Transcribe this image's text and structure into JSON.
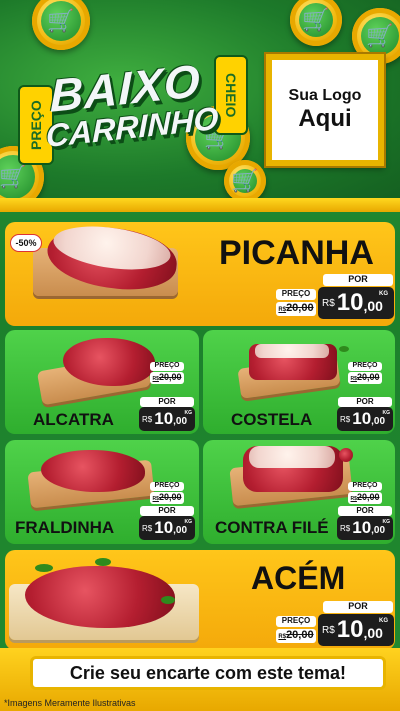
{
  "header": {
    "title_line1": "BAIXO",
    "title_line2": "CARRINHO",
    "side_left": "PREÇO",
    "side_right": "CHEIO",
    "logo_line1": "Sua Logo",
    "logo_line2": "Aqui"
  },
  "products": {
    "picanha": {
      "name": "PICANHA",
      "discount": "-50%",
      "preco_label": "PREÇO",
      "old": "20,00",
      "old_prefix": "R$",
      "por_label": "POR",
      "currency": "R$",
      "int": "10",
      "dec": ",00",
      "unit": "KG"
    },
    "alcatra": {
      "name": "ALCATRA",
      "preco_label": "PREÇO",
      "old": "20,00",
      "old_prefix": "R$",
      "por_label": "POR",
      "currency": "R$",
      "int": "10",
      "dec": ",00",
      "unit": "KG"
    },
    "costela": {
      "name": "COSTELA",
      "preco_label": "PREÇO",
      "old": "20,00",
      "old_prefix": "R$",
      "por_label": "POR",
      "currency": "R$",
      "int": "10",
      "dec": ",00",
      "unit": "KG"
    },
    "fraldinha": {
      "name": "FRALDINHA",
      "preco_label": "PREÇO",
      "old": "20,00",
      "old_prefix": "R$",
      "por_label": "POR",
      "currency": "R$",
      "int": "10",
      "dec": ",00",
      "unit": "KG"
    },
    "contrafile": {
      "name": "CONTRA FILÉ",
      "preco_label": "PREÇO",
      "old": "20,00",
      "old_prefix": "R$",
      "por_label": "POR",
      "currency": "R$",
      "int": "10",
      "dec": ",00",
      "unit": "KG"
    },
    "acem": {
      "name": "ACÉM",
      "preco_label": "PREÇO",
      "old": "20,00",
      "old_prefix": "R$",
      "por_label": "POR",
      "currency": "R$",
      "int": "10",
      "dec": ",00",
      "unit": "KG"
    }
  },
  "cta": "Crie seu encarte com este tema!",
  "disclaimer": "*Imagens Meramente Ilustrativas",
  "icons": {
    "cart": "shopping-cart-icon"
  },
  "colors": {
    "green": "#2fae2e",
    "yellow": "#f4a90a",
    "dark": "#1d1d1d"
  }
}
